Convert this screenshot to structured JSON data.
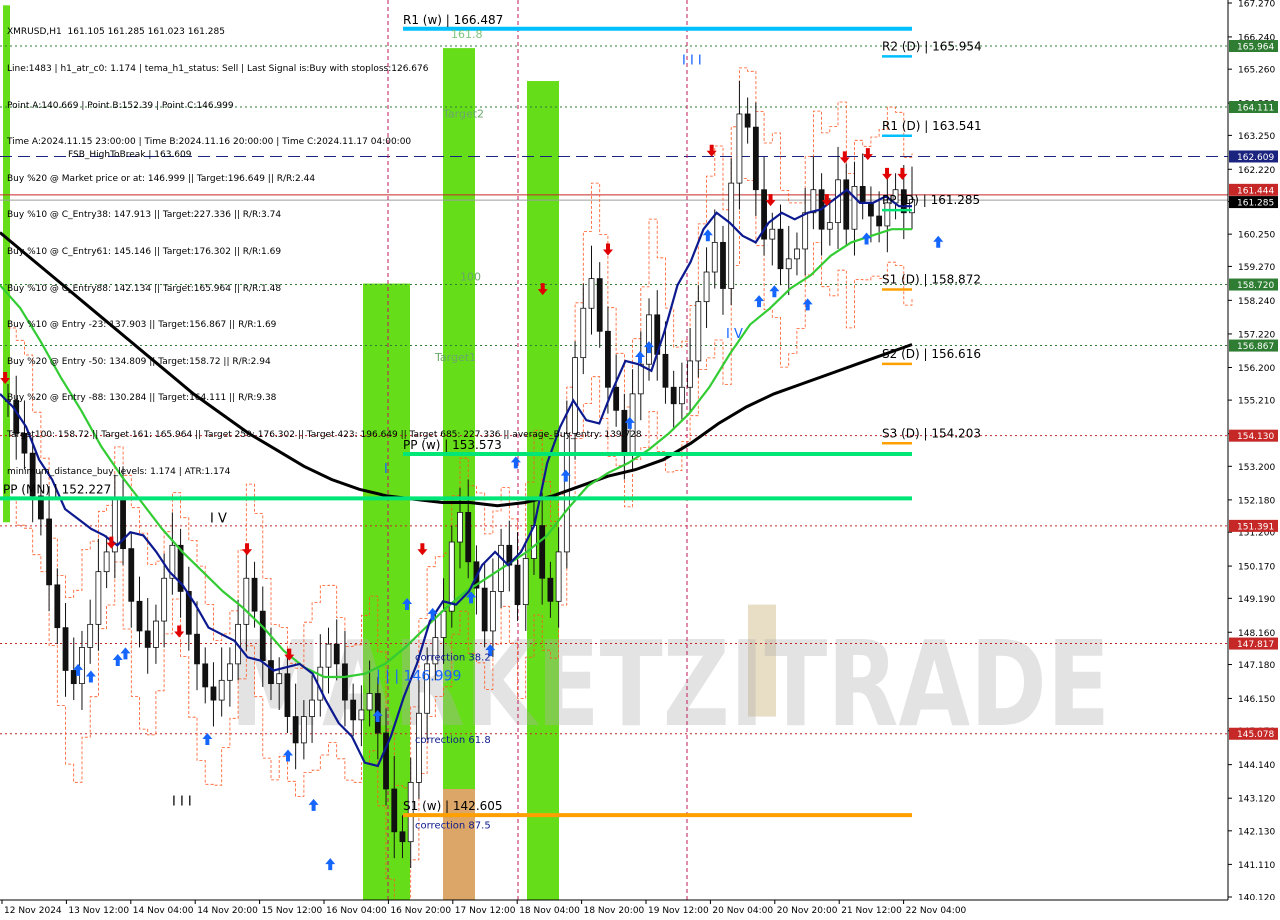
{
  "chart_data": {
    "type": "candlestick",
    "info": {
      "header": "XMRUSD,H1  161.105 161.285 161.023 161.285",
      "lines": [
        "Line:1483 | h1_atr_c0: 1.174 | tema_h1_status: Sell | Last Signal is:Buy with stoploss:126.676",
        "Point A:140.669 | Point B:152.39 | Point C:146.999",
        "Time A:2024.11.15 23:00:00 | Time B:2024.11.16 20:00:00 | Time C:2024.11.17 04:00:00",
        "Buy %20 @ Market price or at: 146.999 || Target:196.649 || R/R:2.44",
        "Buy %10 @ C_Entry38: 147.913 || Target:227.336 || R/R:3.74",
        "Buy %10 @ C_Entry61: 145.146 || Target:176.302 || R/R:1.69",
        "Buy %10 @ C_Entry88: 142.134 || Target:165.964 || R/R:1.48",
        "Buy %10 @ Entry -23: 137.903 || Target:156.867 || R/R:1.69",
        "Buy %20 @ Entry -50: 134.809 || Target:158.72 || R/R:2.94",
        "Buy %20 @ Entry -88: 130.284 || Target:164.111 || R/R:9.38",
        "Target100: 158.72 || Target 161: 165.964 || Target 250: 176.302 || Target 423: 196.649 || Target 685: 227.336 || average_Buy_entry: 139.728",
        "minimum_distance_buy_levels: 1.174 | ATR:1.174"
      ],
      "overlay_label": "FSB_HighToBreak | 163.609"
    },
    "y_axis": {
      "min": 140.12,
      "max": 167.27,
      "ticks": [
        167.27,
        166.24,
        165.26,
        164.23,
        163.25,
        162.22,
        161.24,
        160.25,
        159.27,
        158.24,
        157.22,
        156.2,
        155.21,
        154.19,
        153.2,
        152.18,
        151.2,
        150.17,
        149.19,
        148.16,
        147.18,
        146.15,
        145.17,
        144.14,
        143.12,
        142.13,
        141.11,
        140.12
      ]
    },
    "x_axis": {
      "labels": [
        "12 Nov 2024",
        "13 Nov 12:00",
        "14 Nov 04:00",
        "14 Nov 20:00",
        "15 Nov 12:00",
        "16 Nov 04:00",
        "16 Nov 20:00",
        "17 Nov 12:00",
        "18 Nov 04:00",
        "18 Nov 20:00",
        "19 Nov 12:00",
        "20 Nov 04:00",
        "20 Nov 20:00",
        "21 Nov 12:00",
        "22 Nov 04:00"
      ]
    },
    "price_badges": [
      {
        "value": "165.964",
        "color": "#2e7d32"
      },
      {
        "value": "164.111",
        "color": "#2e7d32"
      },
      {
        "value": "162.609",
        "color": "#1a237e"
      },
      {
        "value": "161.444",
        "color": "#c62828"
      },
      {
        "value": "161.285",
        "color": "#000000"
      },
      {
        "value": "158.720",
        "color": "#2e7d32"
      },
      {
        "value": "156.867",
        "color": "#2e7d32"
      },
      {
        "value": "154.130",
        "color": "#c62828"
      },
      {
        "value": "151.391",
        "color": "#c62828"
      },
      {
        "value": "147.817",
        "color": "#c62828"
      },
      {
        "value": "145.078",
        "color": "#c62828"
      }
    ],
    "pivots": [
      {
        "label": "R1 (w) | 166.487",
        "value": 166.487,
        "color": "#00bfff"
      },
      {
        "label": "PP (w) | 153.573",
        "value": 153.573,
        "color": "#00e676"
      },
      {
        "label": "PP (MN) | 152.227",
        "value": 152.227,
        "color": "#00e676"
      },
      {
        "label": "S1 (w) | 142.605",
        "value": 142.605,
        "color": "#ffa000"
      },
      {
        "label": "R2 (D) | 165.954",
        "value": 165.954,
        "color": "#00bfff"
      },
      {
        "label": "R1 (D) | 163.541",
        "value": 163.541,
        "color": "#00bfff"
      },
      {
        "label": "PP (D) | 161.285",
        "value": 161.285,
        "color": "#00e676"
      },
      {
        "label": "S1 (D) | 158.872",
        "value": 158.872,
        "color": "#ffa000"
      },
      {
        "label": "S2 (D) | 156.616",
        "value": 156.616,
        "color": "#ffa000"
      },
      {
        "label": "S3 (D) | 154.203",
        "value": 154.203,
        "color": "#ffa000"
      }
    ],
    "zone_labels": [
      "161.8",
      "Target2",
      "100",
      "Target1",
      "correction 38.2",
      "correction 61.8",
      "correction 87.5",
      "| | | 146.999"
    ],
    "wave_labels": [
      "I I I",
      "I V",
      "I V",
      "I I I",
      "I"
    ],
    "watermark": "MARKETZITRADE",
    "series": [
      {
        "name": "price",
        "values": [
          155.2,
          154.2,
          153.6,
          152.3,
          151.6,
          149.6,
          148.3,
          147.0,
          146.6,
          147.7,
          148.4,
          150.0,
          150.6,
          152.2,
          150.7,
          149.1,
          148.2,
          147.7,
          148.5,
          149.8,
          150.8,
          149.4,
          148.1,
          147.2,
          146.5,
          146.1,
          146.7,
          147.2,
          148.4,
          149.8,
          148.8,
          147.3,
          146.6,
          146.9,
          145.6,
          144.8,
          145.6,
          146.1,
          147.1,
          147.8,
          147.2,
          146.1,
          145.5,
          145.8,
          146.3,
          145.1,
          143.4,
          142.1,
          141.8,
          143.6,
          145.7,
          147.2,
          148.0,
          148.8,
          150.9,
          151.8,
          150.3,
          149.5,
          148.2,
          149.4,
          150.8,
          150.2,
          149.0,
          150.4,
          151.4,
          149.8,
          149.1,
          150.6,
          154.2,
          156.5,
          158.0,
          158.9,
          157.3,
          155.6,
          154.9,
          153.6,
          155.4,
          156.3,
          157.8,
          156.6,
          155.6,
          155.1,
          155.6,
          156.4,
          158.2,
          159.1,
          160.0,
          158.6,
          161.8,
          163.9,
          163.5,
          161.6,
          160.1,
          160.4,
          159.2,
          159.5,
          159.8,
          160.9,
          161.6,
          160.4,
          160.6,
          161.9,
          160.4,
          161.7,
          161.2,
          160.8,
          160.5,
          161.2,
          161.6,
          160.9,
          161.3
        ]
      },
      {
        "name": "tema",
        "values": [
          155.4,
          155.0,
          154.4,
          153.4,
          152.8,
          151.9,
          151.6,
          151.3,
          151.1,
          150.8,
          151.2,
          151.1,
          150.6,
          150.0,
          149.6,
          149.0,
          148.3,
          148.1,
          147.9,
          147.4,
          147.3,
          147.0,
          147.1,
          147.2,
          146.9,
          146.1,
          145.4,
          145.0,
          144.2,
          144.1,
          145.0,
          146.2,
          147.2,
          148.5,
          149.1,
          149.0,
          149.4,
          150.2,
          150.6,
          150.2,
          150.6,
          151.4,
          153.3,
          154.4,
          155.2,
          154.6,
          154.5,
          155.5,
          156.4,
          156.3,
          156.1,
          157.3,
          158.7,
          159.4,
          160.4,
          160.9,
          160.6,
          160.2,
          160.0,
          160.6,
          160.9,
          160.7,
          160.9,
          161.0,
          161.3,
          161.6,
          161.2,
          161.2,
          161.4,
          161.1,
          161.1
        ]
      },
      {
        "name": "ma-green",
        "values": [
          158.7,
          158.0,
          157.0,
          155.9,
          154.9,
          153.8,
          152.9,
          152.1,
          151.3,
          150.6,
          150.0,
          149.4,
          148.9,
          148.3,
          147.6,
          147.1,
          146.8,
          146.8,
          146.9,
          147.2,
          147.7,
          148.3,
          148.9,
          149.4,
          149.8,
          150.2,
          150.6,
          151.1,
          151.9,
          152.6,
          153.0,
          153.3,
          153.7,
          154.2,
          154.8,
          155.6,
          156.6,
          157.5,
          158.0,
          158.6,
          159.0,
          159.6,
          160.0,
          160.2,
          160.4,
          160.4
        ]
      },
      {
        "name": "ma-black",
        "values": [
          160.3,
          159.6,
          158.9,
          158.2,
          157.5,
          156.8,
          156.1,
          155.4,
          154.8,
          154.2,
          153.7,
          153.2,
          152.8,
          152.5,
          152.3,
          152.2,
          152.1,
          152.1,
          152.0,
          152.1,
          152.3,
          152.6,
          152.9,
          153.1,
          153.4,
          153.9,
          154.5,
          155.0,
          155.4,
          155.7,
          156.0,
          156.3,
          156.6,
          156.9
        ]
      }
    ],
    "markers": {
      "up": [
        [
          0.061,
          147.2
        ],
        [
          0.071,
          147.0
        ],
        [
          0.092,
          147.5
        ],
        [
          0.098,
          147.7
        ],
        [
          0.162,
          145.1
        ],
        [
          0.225,
          144.6
        ],
        [
          0.245,
          143.1
        ],
        [
          0.258,
          141.3
        ],
        [
          0.295,
          145.8
        ],
        [
          0.318,
          149.2
        ],
        [
          0.338,
          148.9
        ],
        [
          0.368,
          149.4
        ],
        [
          0.383,
          147.8
        ],
        [
          0.403,
          153.5
        ],
        [
          0.442,
          153.1
        ],
        [
          0.5,
          156.7
        ],
        [
          0.507,
          157.0
        ],
        [
          0.492,
          154.7
        ],
        [
          0.553,
          160.4
        ],
        [
          0.593,
          158.4
        ],
        [
          0.605,
          158.7
        ],
        [
          0.631,
          158.3
        ],
        [
          0.677,
          160.3
        ],
        [
          0.733,
          160.2
        ]
      ],
      "down": [
        [
          0.004,
          155.7
        ],
        [
          0.087,
          150.7
        ],
        [
          0.14,
          148.0
        ],
        [
          0.193,
          150.5
        ],
        [
          0.226,
          147.3
        ],
        [
          0.33,
          150.5
        ],
        [
          0.424,
          158.4
        ],
        [
          0.475,
          159.6
        ],
        [
          0.556,
          162.6
        ],
        [
          0.602,
          161.1
        ],
        [
          0.646,
          161.1
        ],
        [
          0.66,
          162.4
        ],
        [
          0.678,
          162.5
        ],
        [
          0.693,
          161.9
        ],
        [
          0.705,
          161.9
        ]
      ]
    }
  }
}
